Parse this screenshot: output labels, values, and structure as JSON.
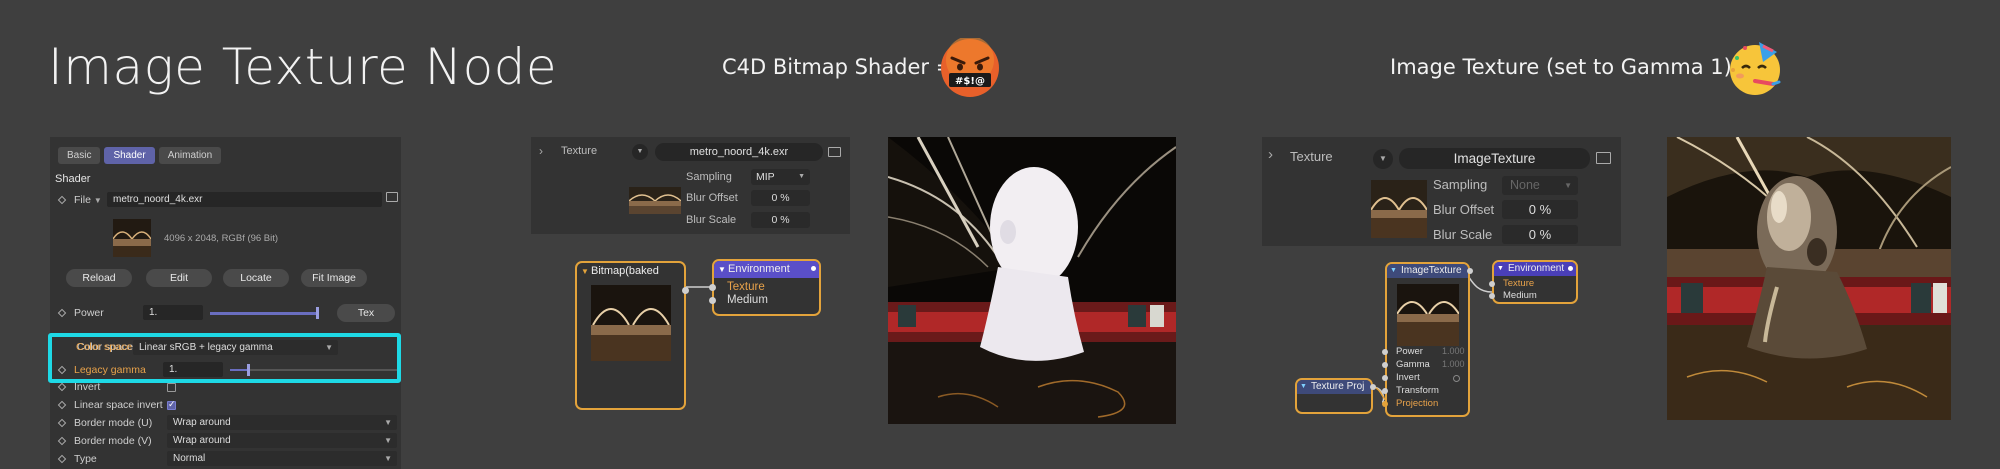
{
  "title": "Image Texture Node",
  "caption_c4d": "C4D Bitmap Shader =",
  "caption_image_texture": "Image Texture (set to Gamma 1) =",
  "emoji_angry_text": "#$!@",
  "emojis": {
    "angry": "cursing-face-emoji",
    "party": "partying-face-emoji"
  },
  "colors": {
    "highlight": "#1ed9e6",
    "accent": "#5f63a8",
    "node_orange": "#e3a33b",
    "label_orange": "#e8a24a"
  },
  "attribute_manager": {
    "tabs": [
      "Basic",
      "Shader",
      "Animation"
    ],
    "active_tab": "Shader",
    "section": "Shader",
    "file_label": "File",
    "file_value": "metro_noord_4k.exr",
    "image_info": "4096 x 2048, RGBf (96 Bit)",
    "buttons": [
      "Reload",
      "Edit",
      "Locate",
      "Fit Image"
    ],
    "power_label": "Power",
    "power_value": "1.",
    "power_button": "Tex",
    "color_space_label": "Color space",
    "color_space_value": "Linear sRGB + legacy gamma",
    "legacy_gamma_label": "Legacy gamma",
    "legacy_gamma_value": "1.",
    "invert_label": "Invert",
    "linear_space_invert_label": "Linear space invert",
    "border_u_label": "Border mode (U)",
    "border_u_value": "Wrap around",
    "border_v_label": "Border mode (V)",
    "border_v_value": "Wrap around",
    "type_label": "Type",
    "type_value": "Normal"
  },
  "c4d_texture": {
    "label": "Texture",
    "file": "metro_noord_4k.exr",
    "sampling_label": "Sampling",
    "sampling_value": "MIP",
    "blur_offset_label": "Blur Offset",
    "blur_offset_value": "0 %",
    "blur_scale_label": "Blur Scale",
    "blur_scale_value": "0 %"
  },
  "c4d_nodes": {
    "bitmap_title": "Bitmap(baked",
    "environment_title": "Environment",
    "ports": [
      "Texture",
      "Medium"
    ]
  },
  "rs_texture": {
    "label": "Texture",
    "file": "ImageTexture",
    "sampling_label": "Sampling",
    "sampling_value": "None",
    "blur_offset_label": "Blur Offset",
    "blur_offset_value": "0 %",
    "blur_scale_label": "Blur Scale",
    "blur_scale_value": "0 %"
  },
  "rs_nodes": {
    "image_texture_title": "ImageTexture",
    "environment_title": "Environment",
    "env_ports": [
      "Texture",
      "Medium"
    ],
    "image_ports": [
      "Power",
      "Gamma",
      "Invert",
      "Transform",
      "Projection"
    ],
    "power_value": "1.000",
    "gamma_value": "1.000",
    "projection_node_title": "Texture Proj"
  }
}
